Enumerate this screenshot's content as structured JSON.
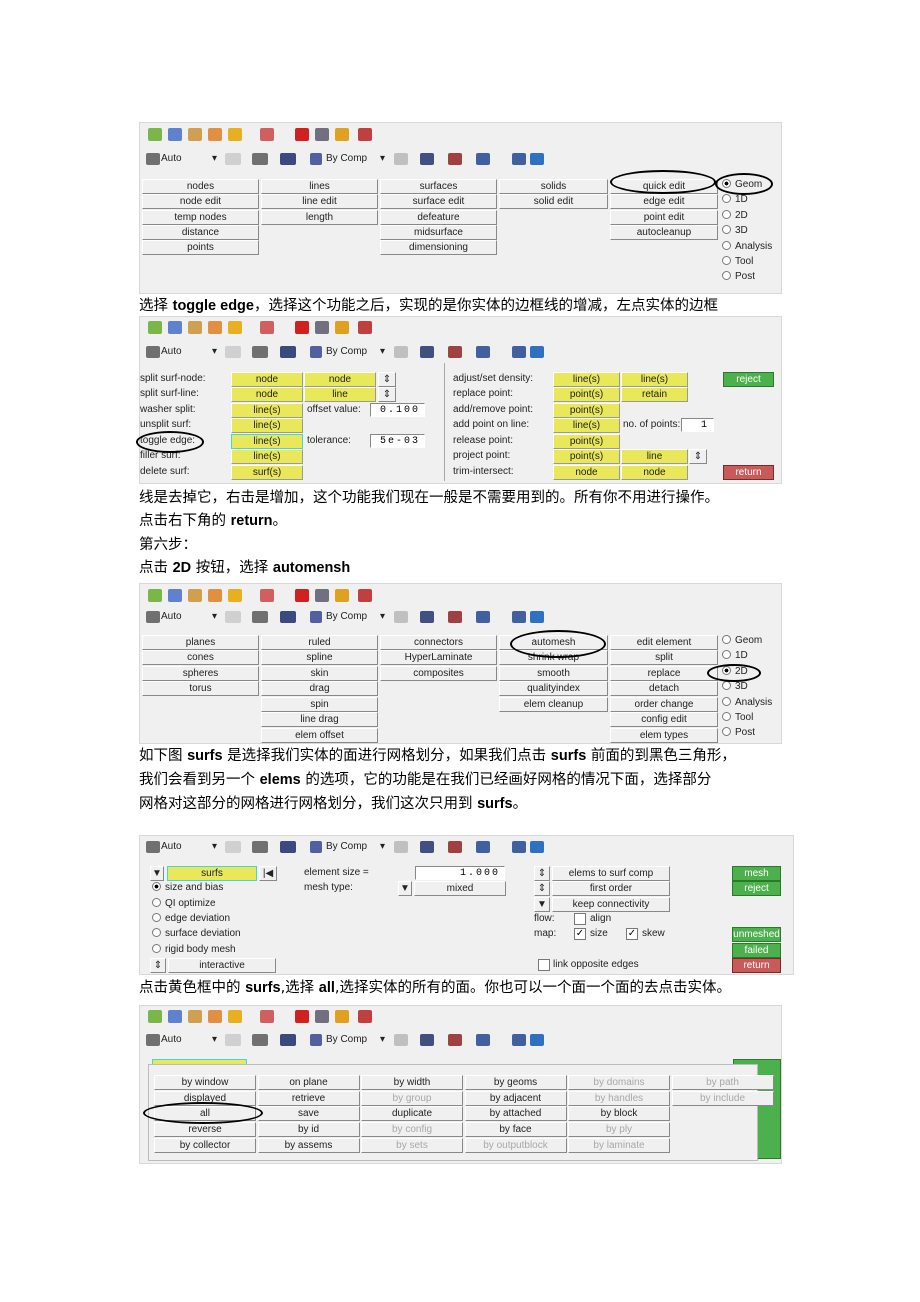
{
  "paragraphs": [
    [
      [
        "选择 ",
        0
      ],
      [
        "toggle edge",
        1
      ],
      [
        "，选择这个功能之后，实现的是你实体的边框线的增减，左点实体的边框",
        0
      ]
    ],
    [
      [
        "线是去掉它，右击是增加，这个功能我们现在一般是不需要用到的。所有你不用进行操作。",
        0
      ]
    ],
    [
      [
        "点击右下角的 ",
        0
      ],
      [
        "return",
        1
      ],
      [
        "。",
        0
      ]
    ],
    [
      [
        "第六步：",
        0
      ]
    ],
    [
      [
        "点击 ",
        0
      ],
      [
        "2D",
        1
      ],
      [
        " 按钮，选择 ",
        0
      ],
      [
        "automensh",
        1
      ]
    ],
    [
      [
        "如下图 ",
        0
      ],
      [
        "surfs",
        1
      ],
      [
        " 是选择我们实体的面进行网格划分，如果我们点击 ",
        0
      ],
      [
        "surfs",
        1
      ],
      [
        " 前面的到黑色三角形，",
        0
      ]
    ],
    [
      [
        "我们会看到另一个 ",
        0
      ],
      [
        "elems",
        1
      ],
      [
        " 的选项，它的功能是在我们已经画好网格的情况下面，选择部分",
        0
      ]
    ],
    [
      [
        "网格对这部分的网格进行网格划分，我们这次只用到 ",
        0
      ],
      [
        "surfs",
        1
      ],
      [
        "。",
        0
      ]
    ],
    [
      [
        "点击黄色框中的 ",
        0
      ],
      [
        "surfs",
        1
      ],
      [
        ",选择 ",
        0
      ],
      [
        "all",
        1
      ],
      [
        ",选择实体的所有的面。你也可以一个面一个面的去点击实体。",
        0
      ]
    ]
  ],
  "toolbar": {
    "auto_label": "Auto",
    "bycomp_label": "By Comp"
  },
  "geom_panel": {
    "columns": [
      [
        "nodes",
        "node edit",
        "temp nodes",
        "distance",
        "points"
      ],
      [
        "lines",
        "line edit",
        "length",
        "",
        ""
      ],
      [
        "surfaces",
        "surface edit",
        "defeature",
        "midsurface",
        "dimensioning"
      ],
      [
        "solids",
        "solid edit",
        "",
        "",
        ""
      ],
      [
        "quick edit",
        "edge edit",
        "point edit",
        "autocleanup",
        ""
      ]
    ],
    "radios": [
      "Geom",
      "1D",
      "2D",
      "3D",
      "Analysis",
      "Tool",
      "Post"
    ],
    "selected_radio": "Geom"
  },
  "quick_edit_panel": {
    "left_labels": [
      "split surf-node:",
      "split surf-line:",
      "washer split:",
      "unsplit surf:",
      "toggle edge:",
      "filler surf:",
      "delete surf:"
    ],
    "left_btn_a": [
      "node",
      "node",
      "line(s)",
      "line(s)",
      "line(s)",
      "line(s)",
      "surf(s)"
    ],
    "left_btn_b": [
      "node",
      "line"
    ],
    "offset_label": "offset value:",
    "offset_value": "0.100",
    "tolerance_label": "tolerance:",
    "tolerance_value": "5e-03",
    "right_labels": [
      "adjust/set density:",
      "replace point:",
      "add/remove point:",
      "add point on line:",
      "release point:",
      "project point:",
      "trim-intersect:"
    ],
    "right_btn_a": [
      "line(s)",
      "point(s)",
      "point(s)",
      "line(s)",
      "point(s)",
      "point(s)",
      "node"
    ],
    "right_btn_b": [
      "line(s)",
      "retain",
      "",
      "",
      "",
      "line",
      "node"
    ],
    "points_label": "no. of points:",
    "points_value": "1",
    "reject": "reject",
    "return": "return"
  },
  "twod_panel": {
    "columns": [
      [
        "planes",
        "cones",
        "spheres",
        "torus"
      ],
      [
        "ruled",
        "spline",
        "skin",
        "drag",
        "spin",
        "line drag",
        "elem offset"
      ],
      [
        "connectors",
        "HyperLaminate",
        "composites"
      ],
      [
        "automesh",
        "shrink wrap",
        "smooth",
        "qualityindex",
        "elem cleanup"
      ],
      [
        "edit element",
        "split",
        "replace",
        "detach",
        "order change",
        "config edit",
        "elem types"
      ]
    ],
    "radios": [
      "Geom",
      "1D",
      "2D",
      "3D",
      "Analysis",
      "Tool",
      "Post"
    ],
    "selected_radio": "2D"
  },
  "automesh_panel": {
    "selector": "surfs",
    "options": [
      "size and bias",
      "QI optimize",
      "edge deviation",
      "surface deviation",
      "rigid body mesh"
    ],
    "selected_option": "size and bias",
    "interactive": "interactive",
    "element_size_label": "element size =",
    "element_size_value": "1.000",
    "mesh_type_label": "mesh type:",
    "mesh_type_value": "mixed",
    "elems_to_surf_comp": "elems to surf comp",
    "first_order": "first order",
    "keep_connectivity": "keep connectivity",
    "flow_label": "flow:",
    "align_label": "align",
    "align_checked": false,
    "map_label": "map:",
    "size_label": "size",
    "size_checked": true,
    "skew_label": "skew",
    "skew_checked": true,
    "link_opposite_edges": "link opposite edges",
    "link_checked": false,
    "mesh": "mesh",
    "reject": "reject",
    "unmeshed": "unmeshed",
    "failed": "failed",
    "return": "return"
  },
  "selection_popup": {
    "columns": [
      [
        {
          "label": "by window"
        },
        {
          "label": "displayed"
        },
        {
          "label": "all"
        },
        {
          "label": "reverse"
        },
        {
          "label": "by collector"
        }
      ],
      [
        {
          "label": "on plane"
        },
        {
          "label": "retrieve"
        },
        {
          "label": "save"
        },
        {
          "label": "by id"
        },
        {
          "label": "by assems"
        }
      ],
      [
        {
          "label": "by width"
        },
        {
          "label": "by group",
          "disabled": true
        },
        {
          "label": "duplicate"
        },
        {
          "label": "by config",
          "disabled": true
        },
        {
          "label": "by sets",
          "disabled": true
        }
      ],
      [
        {
          "label": "by geoms"
        },
        {
          "label": "by adjacent"
        },
        {
          "label": "by attached"
        },
        {
          "label": "by face"
        },
        {
          "label": "by outputblock",
          "disabled": true
        }
      ],
      [
        {
          "label": "by domains",
          "disabled": true
        },
        {
          "label": "by handles",
          "disabled": true
        },
        {
          "label": "by block"
        },
        {
          "label": "by ply",
          "disabled": true
        },
        {
          "label": "by laminate",
          "disabled": true
        }
      ],
      [
        {
          "label": "by path",
          "disabled": true
        },
        {
          "label": "by include",
          "disabled": true
        }
      ]
    ]
  },
  "colors": {
    "yellow": "#e8e85a",
    "green": "#4cb04c",
    "red": "#c85a5a",
    "panel": "#f0f0f0"
  }
}
